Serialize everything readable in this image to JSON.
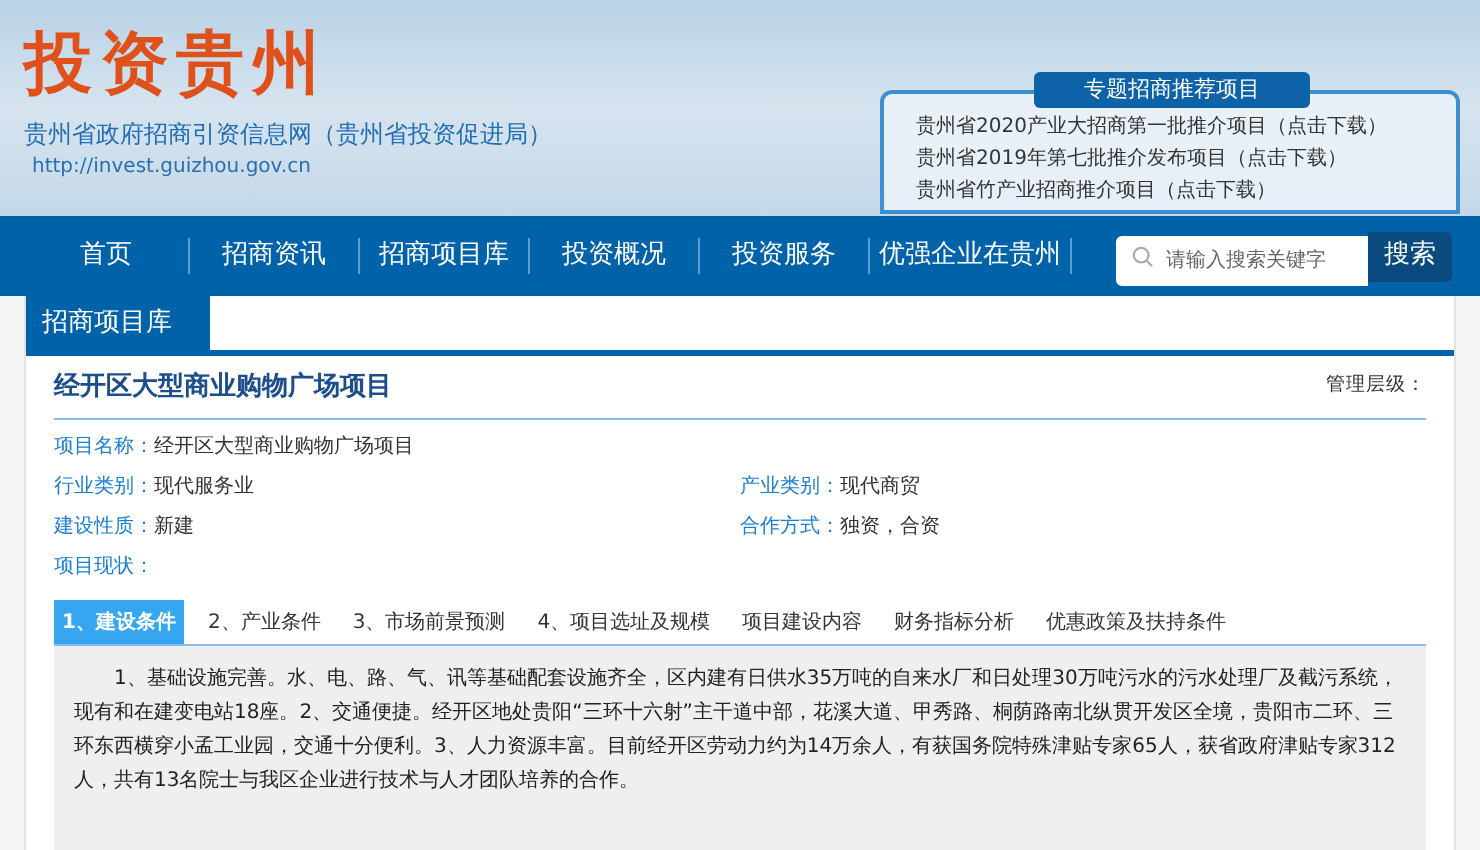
{
  "header": {
    "logo": "投资贵州",
    "site_title": "贵州省政府招商引资信息网（贵州省投资促进局）",
    "url": "http://invest.guizhou.gov.cn"
  },
  "featured": {
    "title": "专题招商推荐项目",
    "items": [
      "贵州省2020产业大招商第一批推介项目（点击下载）",
      "贵州省2019年第七批推介发布项目（点击下载）",
      "贵州省竹产业招商推介项目（点击下载）"
    ]
  },
  "nav": {
    "items": [
      {
        "label": "首页",
        "selected": false
      },
      {
        "label": "招商资讯",
        "selected": false
      },
      {
        "label": "招商项目库",
        "selected": false
      },
      {
        "label": "投资概况",
        "selected": false
      },
      {
        "label": "投资服务",
        "selected": false
      },
      {
        "label": "优强企业在贵州",
        "selected": false
      }
    ],
    "search": {
      "placeholder": "请输入搜索关键字",
      "button": "搜索"
    }
  },
  "section_title": "招商项目库",
  "project": {
    "title": "经开区大型商业购物广场项目",
    "level_label": "管理层级：",
    "fields": [
      {
        "label": "项目名称：",
        "value": "经开区大型商业购物广场项目"
      },
      {
        "label": "行业类别：",
        "value": "现代服务业"
      },
      {
        "label": "产业类别：",
        "value": "现代商贸"
      },
      {
        "label": "建设性质：",
        "value": "新建"
      },
      {
        "label": "合作方式：",
        "value": "独资，合资"
      },
      {
        "label": "项目现状："
      }
    ]
  },
  "tabs": [
    {
      "label": "1、建设条件",
      "selected": true
    },
    {
      "label": "2、产业条件",
      "selected": false
    },
    {
      "label": "3、市场前景预测",
      "selected": false
    },
    {
      "label": "4、项目选址及规模",
      "selected": false
    },
    {
      "label": "项目建设内容",
      "selected": false
    },
    {
      "label": "财务指标分析",
      "selected": false
    },
    {
      "label": "优惠政策及扶持条件",
      "selected": false
    }
  ],
  "tab_content": "1、基础设施完善。水、电、路、气、讯等基础配套设施齐全，区内建有日供水35万吨的自来水厂和日处理30万吨污水的污水处理厂及截污系统，现有和在建变电站18座。2、交通便捷。经开区地处贵阳“三环十六射”主干道中部，花溪大道、甲秀路、桐荫路南北纵贯开发区全境，贵阳市二环、三环东西横穿小孟工业园，交通十分便利。3、人力资源丰富。目前经开区劳动力约为14万余人，有获国务院特殊津贴专家65人，获省政府津贴专家312人，共有13名院士与我区企业进行技术与人才团队培养的合作。"
}
